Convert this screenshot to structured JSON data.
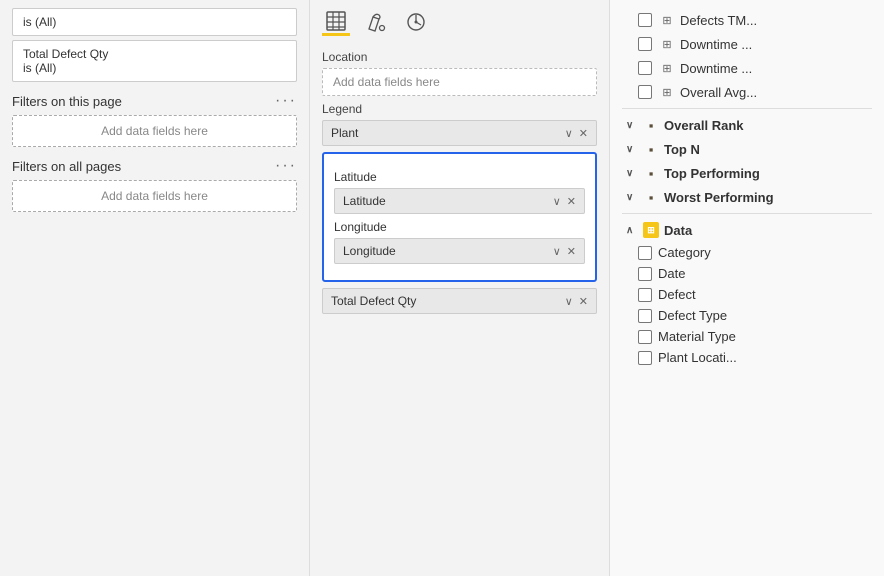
{
  "left_panel": {
    "filter_item_1": "is (All)",
    "filter_item_2_label": "Total Defect Qty",
    "filter_item_2_value": "is (All)",
    "filters_this_page_label": "Filters on this page",
    "add_data_1": "Add data fields here",
    "filters_all_pages_label": "Filters on all pages",
    "add_data_2": "Add data fields here"
  },
  "middle_panel": {
    "toolbar_icons": [
      "table-icon",
      "paint-icon",
      "analytics-icon"
    ],
    "location_label": "Location",
    "location_add": "Add data fields here",
    "legend_label": "Legend",
    "legend_tag": "Plant",
    "latitude_label": "Latitude",
    "latitude_tag": "Latitude",
    "longitude_label": "Longitude",
    "longitude_tag": "Longitude",
    "total_defect_label": "Total Defect Qty"
  },
  "right_panel": {
    "items": [
      {
        "type": "calc",
        "label": "Defects TM...",
        "indent": 1
      },
      {
        "type": "calc",
        "label": "Downtime ...",
        "indent": 1
      },
      {
        "type": "calc",
        "label": "Downtime ...",
        "indent": 1
      },
      {
        "type": "calc",
        "label": "Overall Avg...",
        "indent": 1
      },
      {
        "type": "folder",
        "label": "Overall Rank",
        "indent": 0
      },
      {
        "type": "folder",
        "label": "Top N",
        "indent": 0
      },
      {
        "type": "folder",
        "label": "Top Performing",
        "indent": 0
      },
      {
        "type": "folder",
        "label": "Worst Performing",
        "indent": 0
      },
      {
        "type": "table-yellow",
        "label": "Data",
        "indent": 0
      },
      {
        "type": "checkbox",
        "label": "Category",
        "indent": 1
      },
      {
        "type": "checkbox",
        "label": "Date",
        "indent": 1
      },
      {
        "type": "checkbox",
        "label": "Defect",
        "indent": 1
      },
      {
        "type": "checkbox",
        "label": "Defect Type",
        "indent": 1
      },
      {
        "type": "checkbox",
        "label": "Material Type",
        "indent": 1
      },
      {
        "type": "checkbox",
        "label": "Plant Locati...",
        "indent": 1
      }
    ]
  }
}
